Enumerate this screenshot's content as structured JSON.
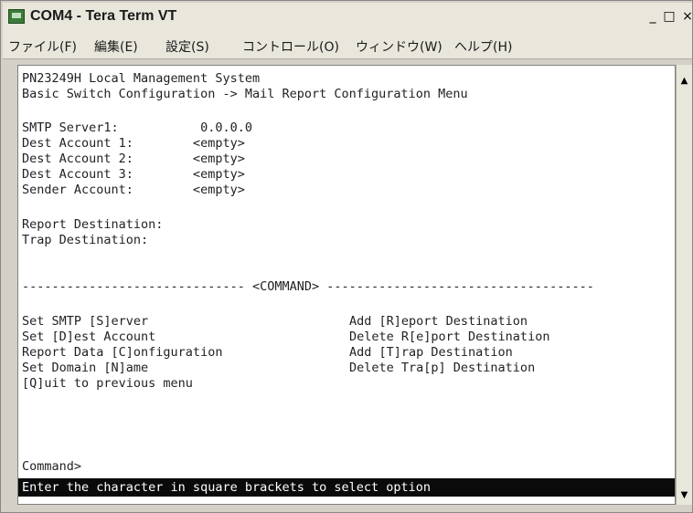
{
  "window": {
    "title": "COM4 - Tera Term VT",
    "min_label": "_",
    "max_label": "□",
    "close_label": "×"
  },
  "menu": [
    "ファイル(F)",
    "編集(E)",
    "設定(S)",
    "コントロール(O)",
    "ウィンドウ(W)",
    "ヘルプ(H)"
  ],
  "terminal": {
    "header1": "PN23249H Local Management System",
    "header2": "Basic Switch Configuration -> Mail Report Configuration Menu",
    "fields": [
      "SMTP Server1:           0.0.0.0",
      "Dest Account 1:        <empty>",
      "Dest Account 2:        <empty>",
      "Dest Account 3:        <empty>",
      "Sender Account:        <empty>"
    ],
    "report_dest": "Report Destination:",
    "trap_dest": "Trap Destination:",
    "divider": "------------------------------ <COMMAND> ------------------------------------",
    "commands_left": [
      "Set SMTP [S]erver",
      "Set [D]est Account",
      "Report Data [C]onfiguration",
      "Set Domain [N]ame",
      "[Q]uit to previous menu"
    ],
    "commands_right": [
      "Add [R]eport Destination",
      "Delete R[e]port Destination",
      "Add [T]rap Destination",
      "Delete Tra[p] Destination"
    ],
    "prompt": "Command>",
    "status": "Enter the character in square brackets to select option"
  },
  "scrollbar": {
    "up_icon": "▲",
    "down_icon": "▼"
  }
}
